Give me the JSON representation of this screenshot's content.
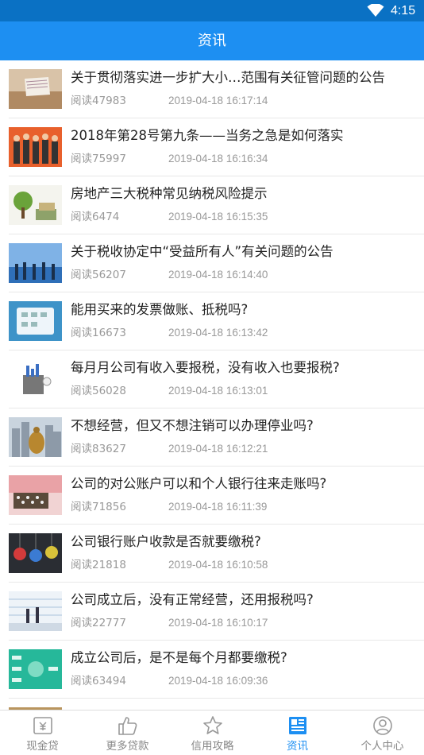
{
  "status": {
    "time": "4:15"
  },
  "header": {
    "title": "资讯"
  },
  "articles": [
    {
      "title": "关于贯彻落实进一步扩大小…范围有关征管问题的公告",
      "reads": "阅读47983",
      "date": "2019-04-18 16:17:14"
    },
    {
      "title": "2018年第28号第九条——当务之急是如何落实",
      "reads": "阅读75997",
      "date": "2019-04-18 16:16:34"
    },
    {
      "title": "房地产三大税种常见纳税风险提示",
      "reads": "阅读6474",
      "date": "2019-04-18 16:15:35"
    },
    {
      "title": "关于税收协定中“受益所有人”有关问题的公告",
      "reads": "阅读56207",
      "date": "2019-04-18 16:14:40"
    },
    {
      "title": "能用买来的发票做账、抵税吗?",
      "reads": "阅读16673",
      "date": "2019-04-18 16:13:42"
    },
    {
      "title": "每月月公司有收入要报税，没有收入也要报税?",
      "reads": "阅读56028",
      "date": "2019-04-18 16:13:01"
    },
    {
      "title": "不想经营，但又不想注销可以办理停业吗?",
      "reads": "阅读83627",
      "date": "2019-04-18 16:12:21"
    },
    {
      "title": "公司的对公账户可以和个人银行往来走账吗?",
      "reads": "阅读71856",
      "date": "2019-04-18 16:11:39"
    },
    {
      "title": "公司银行账户收款是否就要缴税?",
      "reads": "阅读21818",
      "date": "2019-04-18 16:10:58"
    },
    {
      "title": "公司成立后，没有正常经营，还用报税吗?",
      "reads": "阅读22777",
      "date": "2019-04-18 16:10:17"
    },
    {
      "title": "成立公司后，是不是每个月都要缴税?",
      "reads": "阅读63494",
      "date": "2019-04-18 16:09:36"
    }
  ],
  "tabs": [
    {
      "label": "现金贷",
      "icon": "cash-icon"
    },
    {
      "label": "更多贷款",
      "icon": "thumbs-up-icon"
    },
    {
      "label": "信用攻略",
      "icon": "star-icon"
    },
    {
      "label": "资讯",
      "icon": "news-icon",
      "active": true
    },
    {
      "label": "个人中心",
      "icon": "user-icon"
    }
  ],
  "colors": {
    "statusbar": "#0a71c4",
    "appbar": "#1d8ff2",
    "accent": "#1d8ff2",
    "muted": "#999999"
  }
}
